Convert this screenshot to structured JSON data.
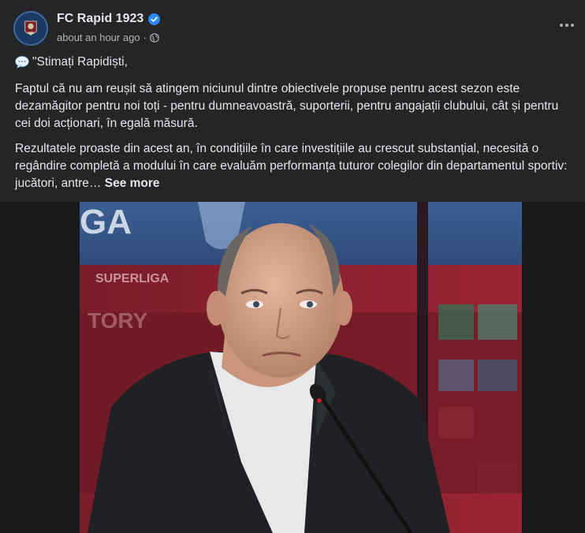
{
  "post": {
    "page_name": "FC Rapid 1923",
    "timestamp": "about an hour ago",
    "separator": "·",
    "verified": true,
    "privacy_icon": "globe-icon",
    "menu_icon": "more-options-icon"
  },
  "text": {
    "line1": "\"Stimați Rapidiști,",
    "paragraph1": "Faptul că nu am reușit să atingem niciunul dintre obiectivele propuse pentru acest sezon este dezamăgitor pentru noi toți - pentru dumneavoastră, suporterii, pentru angajații clubului, cât și pentru cei doi acționari, în egală măsură.",
    "paragraph2": "Rezultatele proaste din acest an, în condițiile în care investițiile au crescut substanțial, necesită o regândire completă a modului în care evaluăm performanța tuturor colegilor din departamentul sportiv: jucători, antre…",
    "see_more": "See more"
  },
  "image": {
    "banner_texts": [
      "GA",
      "SUPERLIGA",
      "TORY"
    ]
  },
  "colors": {
    "background": "#242526",
    "text": "#e4e6eb",
    "secondary_text": "#b0b3b8",
    "verified_blue": "#2d88ff"
  }
}
